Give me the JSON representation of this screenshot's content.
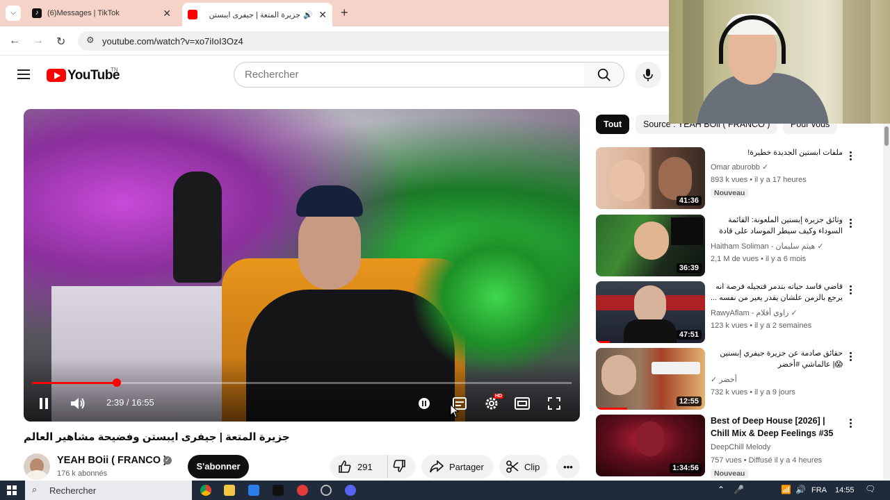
{
  "browser": {
    "tabs": [
      {
        "title": "(6)Messages | TikTok",
        "active": false
      },
      {
        "title": "جزيرة المتعة | جيفرى ايبستن",
        "active": true
      }
    ],
    "url": "youtube.com/watch?v=xo7iIoI3Oz4"
  },
  "header": {
    "logo": "YouTube",
    "logo_suffix": "TN",
    "search_placeholder": "Rechercher"
  },
  "player": {
    "time": "2:39 / 16:55",
    "progress": 0.157,
    "hd_badge": "HD"
  },
  "video": {
    "title": "جزيرة المتعة | جيفرى ايبستن وفضيحة مشاهير العالم",
    "channel": "YEAH BOii ( FRANCO )",
    "subscribers": "176 k abonnés",
    "subscribe": "S'abonner",
    "likes": "291",
    "share": "Partager",
    "clip": "Clip"
  },
  "chips": [
    "Tout",
    "Source : YEAH BOii ( FRANCO )",
    "Pour vous"
  ],
  "recommendations": [
    {
      "title": "ملفات ابستين الجديدة خطيرة!",
      "channel": "Omar aburobb",
      "meta": "893 k vues • il y a 17 heures",
      "badge": "Nouveau",
      "duration": "41:36",
      "rtl": true
    },
    {
      "title": "وثائق جزيرة إبستين الملعونة: القائمة السوداء وكيف سيطر الموساد على قادة العالم؟",
      "channel": "Haitham Soliman - هيثم سليمان",
      "meta": "2,1 M de vues • il y a 6 mois",
      "badge": "",
      "duration": "36:39",
      "rtl": true
    },
    {
      "title": "قاضي فاسد حياته بتدمر فتجيله فرصة انه يرجع بالزمن علشان يقدر يغير من نفسه ...",
      "channel": "RawyAflam - راوي أفلام",
      "meta": "123 k vues • il y a 2 semaines",
      "badge": "",
      "duration": "47:51",
      "rtl": true
    },
    {
      "title": "حقائق صادمة عن جزيرة جيفري إبستين 😱| عالماشي #أخضر",
      "channel": "أخضر",
      "meta": "732 k vues • il y a 9 jours",
      "badge": "",
      "duration": "12:55",
      "rtl": true
    },
    {
      "title": "Best of Deep House [2026] | Chill Mix & Deep Feelings #35",
      "channel": "DeepChill Melody",
      "meta": "757 vues • Diffusé il y a 4 heures",
      "badge": "Nouveau",
      "duration": "1:34:56",
      "rtl": false
    }
  ],
  "taskbar": {
    "search": "Rechercher",
    "lang": "FRA",
    "clock": "14:55"
  }
}
